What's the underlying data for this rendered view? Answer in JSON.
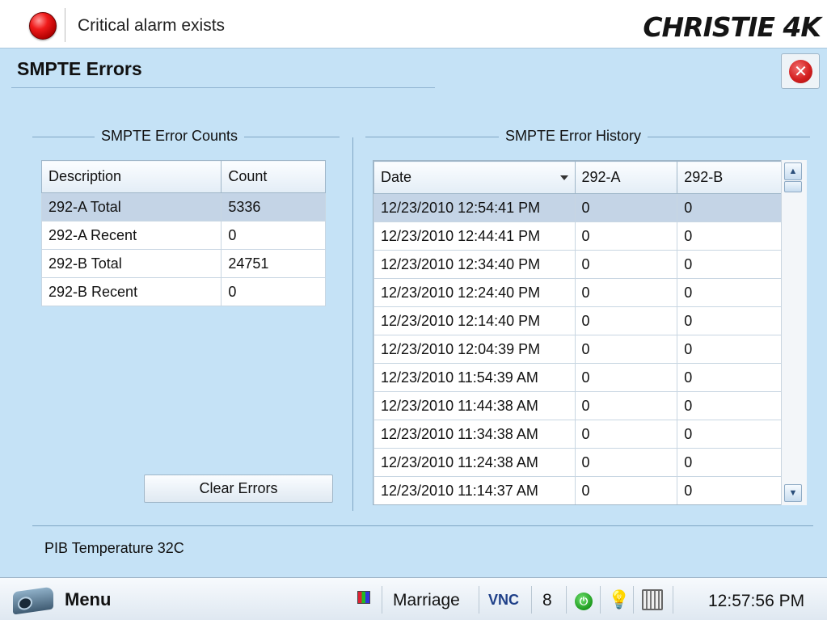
{
  "status": {
    "alarm_text": "Critical alarm exists",
    "alarm_color": "#e01010",
    "brand": "CHRISTIE 4K"
  },
  "page": {
    "title": "SMPTE Errors",
    "close_icon": "close-circle-icon"
  },
  "counts": {
    "title": "SMPTE Error Counts",
    "headers": [
      "Description",
      "Count"
    ],
    "rows": [
      {
        "description": "292-A Total",
        "count": "5336"
      },
      {
        "description": "292-A Recent",
        "count": "0"
      },
      {
        "description": "292-B Total",
        "count": "24751"
      },
      {
        "description": "292-B Recent",
        "count": "0"
      }
    ],
    "clear_label": "Clear Errors"
  },
  "history": {
    "title": "SMPTE Error History",
    "headers": [
      "Date",
      "292-A",
      "292-B"
    ],
    "rows": [
      {
        "date": "12/23/2010 12:54:41 PM",
        "a": "0",
        "b": "0"
      },
      {
        "date": "12/23/2010 12:44:41 PM",
        "a": "0",
        "b": "0"
      },
      {
        "date": "12/23/2010 12:34:40 PM",
        "a": "0",
        "b": "0"
      },
      {
        "date": "12/23/2010 12:24:40 PM",
        "a": "0",
        "b": "0"
      },
      {
        "date": "12/23/2010 12:14:40 PM",
        "a": "0",
        "b": "0"
      },
      {
        "date": "12/23/2010 12:04:39 PM",
        "a": "0",
        "b": "0"
      },
      {
        "date": "12/23/2010 11:54:39 AM",
        "a": "0",
        "b": "0"
      },
      {
        "date": "12/23/2010 11:44:38 AM",
        "a": "0",
        "b": "0"
      },
      {
        "date": "12/23/2010 11:34:38 AM",
        "a": "0",
        "b": "0"
      },
      {
        "date": "12/23/2010 11:24:38 AM",
        "a": "0",
        "b": "0"
      },
      {
        "date": "12/23/2010 11:14:37 AM",
        "a": "0",
        "b": "0"
      }
    ]
  },
  "footer": {
    "pib_temp": "PIB Temperature 32C"
  },
  "taskbar": {
    "menu_label": "Menu",
    "marriage": "Marriage",
    "vnc": "VNC",
    "count": "8",
    "clock": "12:57:56 PM"
  }
}
